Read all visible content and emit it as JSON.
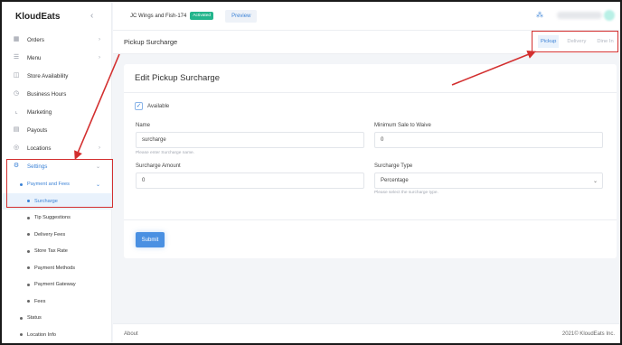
{
  "brand": {
    "name": "KloudEats",
    "collapse_icon": "chevron-left-icon"
  },
  "sidebar": {
    "items": [
      {
        "label": "Orders",
        "icon": "orders-icon",
        "chevron": "›"
      },
      {
        "label": "Menu",
        "icon": "menu-icon",
        "chevron": "›"
      },
      {
        "label": "Store Availability",
        "icon": "store-icon",
        "chevron": ""
      },
      {
        "label": "Business Hours",
        "icon": "clock-icon",
        "chevron": ""
      },
      {
        "label": "Marketing",
        "icon": "chart-icon",
        "chevron": ""
      },
      {
        "label": "Payouts",
        "icon": "wallet-icon",
        "chevron": ""
      },
      {
        "label": "Locations",
        "icon": "location-icon",
        "chevron": "›"
      },
      {
        "label": "Settings",
        "icon": "gear-icon",
        "chevron": "⌄"
      }
    ],
    "payment_and_fees": "Payment and Fees",
    "sub_items": [
      "Surcharge",
      "Tip Suggestions",
      "Delivery Fees",
      "Store Tax Rate",
      "Payment Methods",
      "Payment Gateway",
      "Fees"
    ],
    "status": "Status",
    "location_info": "Location Info"
  },
  "topbar": {
    "store_name": "JC Wings and Fish-174",
    "badge": "Activated",
    "preview": "Preview"
  },
  "page": {
    "title": "Pickup Surcharge",
    "tabs": [
      "Pickup",
      "Delivery",
      "Dine In"
    ]
  },
  "form": {
    "heading": "Edit Pickup Surcharge",
    "available_label": "Available",
    "name_label": "Name",
    "name_value": "surcharge",
    "name_hint": "Please enter Surcharge name.",
    "min_sale_label": "Minimum Sale to Waive",
    "min_sale_value": "0",
    "amount_label": "Surcharge Amount",
    "amount_value": "0",
    "type_label": "Surcharge Type",
    "type_value": "Percentage",
    "type_hint": "Please select the surcharge type.",
    "submit": "Submit"
  },
  "footer": {
    "about": "About",
    "copyright": "2021© KloudEats Inc."
  },
  "colors": {
    "accent": "#3b82d6",
    "badge": "#23b58c",
    "annotation": "#d32f2f"
  }
}
